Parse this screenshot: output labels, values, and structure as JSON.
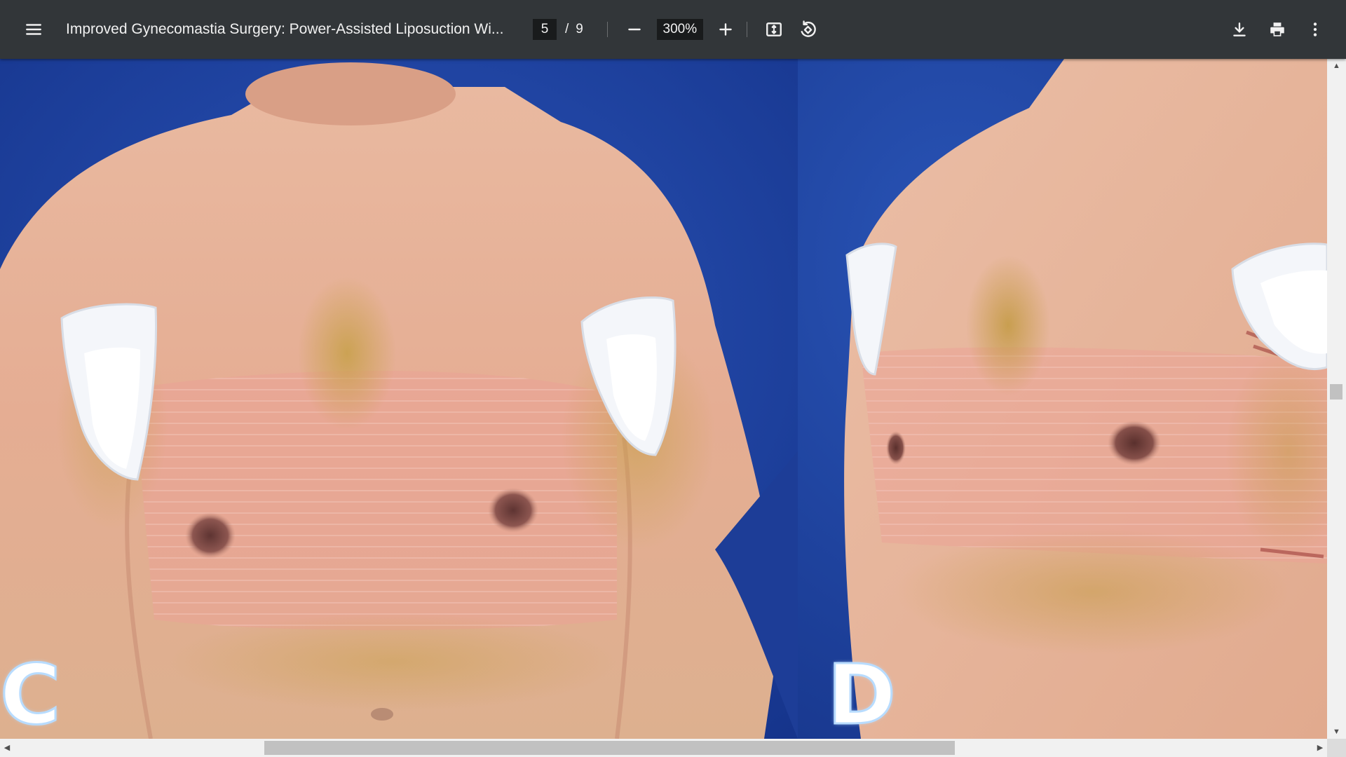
{
  "toolbar": {
    "document_title": "Improved Gynecomastia Surgery: Power-Assisted Liposuction Wi...",
    "current_page": "5",
    "page_separator": "/",
    "total_pages": "9",
    "zoom_value": "300%",
    "icons": {
      "menu": "menu-icon",
      "zoom_out": "minus-icon",
      "zoom_in": "plus-icon",
      "fit": "fit-to-page-icon",
      "rotate": "rotate-counterclockwise-icon",
      "download": "download-icon",
      "print": "print-icon",
      "more": "more-vertical-icon"
    }
  },
  "document": {
    "figure_panels": [
      {
        "letter": "C"
      },
      {
        "letter": "D"
      }
    ]
  },
  "colors": {
    "toolbar_bg": "#323639",
    "viewer_bg": "#525659",
    "photo_backdrop": "#1c3f9c",
    "skin": "#e8b69c"
  }
}
